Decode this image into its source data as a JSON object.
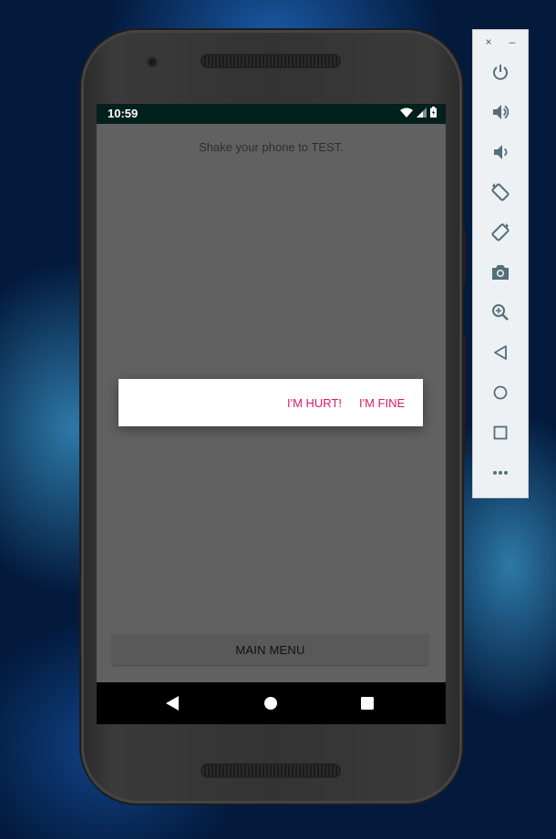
{
  "status_bar": {
    "time": "10:59",
    "icons": [
      "wifi-icon",
      "signal-icon",
      "battery-icon"
    ]
  },
  "app": {
    "instruction": "Shake your phone to TEST.",
    "main_menu_label": "MAIN MENU"
  },
  "dialog": {
    "hurt_label": "I'M HURT!",
    "fine_label": "I'M FINE",
    "accent_color": "#d81b60"
  },
  "navigation": {
    "items": [
      "back-icon",
      "home-icon",
      "recents-icon"
    ]
  },
  "emulator_toolbar": {
    "close_label": "×",
    "minimize_label": "–",
    "tools": [
      "power-icon",
      "volume-up-icon",
      "volume-down-icon",
      "rotate-left-icon",
      "rotate-right-icon",
      "camera-icon",
      "zoom-icon",
      "back-icon",
      "home-icon",
      "overview-icon",
      "more-icon"
    ]
  },
  "colors": {
    "status_bar": "#02201c",
    "dim_screen": "#616161",
    "toolbar_icon": "#546e7a"
  }
}
